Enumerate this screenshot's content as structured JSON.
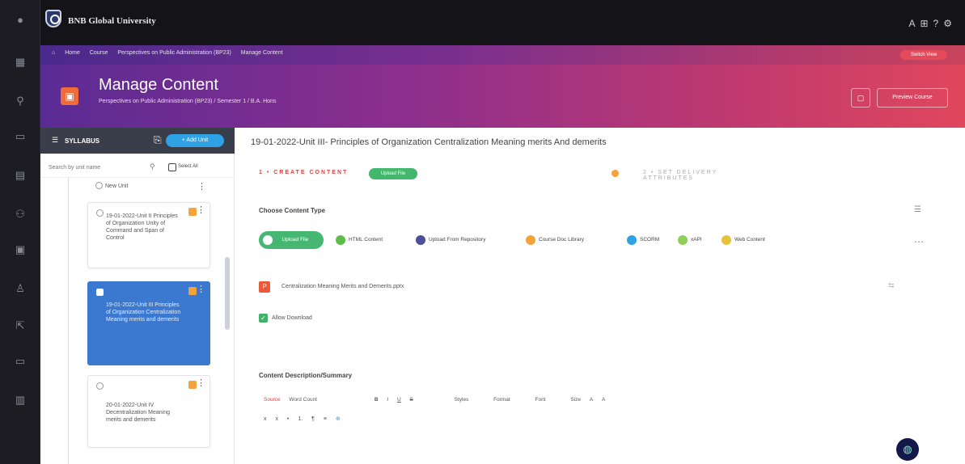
{
  "topbar": {
    "university": "BNB Global University",
    "icons": [
      "translate-icon",
      "grid-icon",
      "help-icon",
      "account-icon"
    ]
  },
  "rail": {
    "icons": [
      "menu-icon",
      "dashboard-icon",
      "user-icon",
      "book-icon",
      "calendar-icon",
      "people-icon",
      "document-icon",
      "group-icon",
      "share-icon",
      "monitor-icon",
      "report-icon"
    ]
  },
  "breadcrumb": {
    "items": [
      "Home",
      "Course",
      "Perspectives on Public Administration (BP23)",
      "Manage Content"
    ],
    "badge": "Switch View"
  },
  "header": {
    "title": "Manage Content",
    "subtitle": "Perspectives on Public Administration (BP23) / Semester 1 / B.A. Hons",
    "button": "Preview Course"
  },
  "syllabus": {
    "label": "SYLLABUS",
    "add_button": "+ Add Unit",
    "search_placeholder": "Search by unit name",
    "select_all": "Select All",
    "items": [
      {
        "text": "New Unit",
        "selected": false
      },
      {
        "text": "19-01-2022-Unit II Principles of Organization Unity of Command and Span of Control",
        "selected": false
      },
      {
        "text": "19-01-2022-Unit III Principles of Organization Centralization Meaning merits and demerits",
        "selected": true
      },
      {
        "text": "20-01-2022-Unit IV Decentralization Meaning merits and demerits",
        "selected": false
      }
    ]
  },
  "main": {
    "title": "19-01-2022-Unit III- Principles of Organization Centralization Meaning merits And demerits",
    "tab_create": "1 • CREATE CONTENT",
    "tab_badge": "Upload File",
    "tab_attrs": "2 • SET DELIVERY ATTRIBUTES",
    "choose_type": "Choose Content Type",
    "content_types": [
      {
        "label": "Upload File",
        "color": "#45b772"
      },
      {
        "label": "HTML Content",
        "color": "#5fbb4a"
      },
      {
        "label": "Upload From Repository",
        "color": "#4a4f9a"
      },
      {
        "label": "Course Doc Library",
        "color": "#f3a33a"
      },
      {
        "label": "SCORM",
        "color": "#2fa1e5"
      },
      {
        "label": "xAPI",
        "color": "#8fcf5a"
      },
      {
        "label": "Web Content",
        "color": "#e6c23a"
      }
    ],
    "file_name": "Centralization Meaning Merits and Demerits.pptx",
    "allow_download": "Allow Download",
    "desc_title": "Content Description/Summary",
    "toolbar_row1": [
      "Source",
      "Word Count",
      "B",
      "I",
      "U",
      "S",
      "Styles",
      "Format",
      "Font",
      "Size",
      "A",
      "A"
    ],
    "toolbar_row2": [
      "x",
      "x",
      "•",
      "1.",
      "¶",
      "≡",
      "⊕"
    ]
  },
  "colors": {
    "accent_start": "#5a2b94",
    "accent_end": "#e0475c",
    "selected_item": "#3b78cf",
    "upload_green": "#45b772"
  }
}
